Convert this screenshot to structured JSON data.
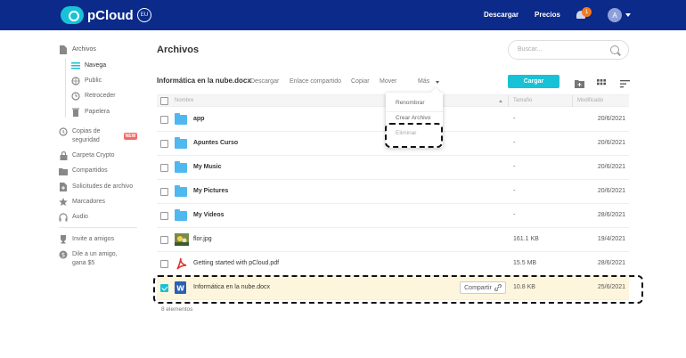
{
  "brand": {
    "name": "pCloud",
    "region": "EU"
  },
  "topnav": {
    "download": "Descargar",
    "prices": "Precios",
    "notifications_count": "1",
    "avatar_initial": "A"
  },
  "sidebar": {
    "files": "Archivos",
    "browse": "Navega",
    "public": "Public",
    "rewind": "Retroceder",
    "trash": "Papelera",
    "backups": "Copias de seguridad",
    "new_badge": "NEW",
    "crypto": "Carpeta Crypto",
    "shared": "Compartidos",
    "file_requests": "Solicitudes de archivo",
    "bookmarks": "Marcadores",
    "audio": "Audio",
    "invite": "Invite a amigos",
    "refer": "Dile a un amigo, gana $5"
  },
  "main": {
    "title": "Archivos",
    "search_placeholder": "Buscar...",
    "selected_file": "Informática en la nube.docx",
    "actions": {
      "download": "Descargar",
      "share_link": "Enlace compartido",
      "copy": "Copiar",
      "move": "Mover",
      "more": "Más"
    },
    "upload": "Cargar",
    "columns": {
      "name": "Nombre",
      "size": "Tamaño",
      "modified": "Modificado"
    },
    "more_menu": [
      "Renombrar",
      "Crear Archivo",
      "Eliminar"
    ],
    "rows": [
      {
        "name": "app",
        "size": "-",
        "date": "20/6/2021",
        "type": "folder"
      },
      {
        "name": "Apuntes Curso",
        "size": "-",
        "date": "20/6/2021",
        "type": "folder"
      },
      {
        "name": "My Music",
        "size": "-",
        "date": "20/6/2021",
        "type": "folder"
      },
      {
        "name": "My Pictures",
        "size": "-",
        "date": "20/6/2021",
        "type": "folder"
      },
      {
        "name": "My Videos",
        "size": "-",
        "date": "28/6/2021",
        "type": "folder"
      },
      {
        "name": "flor.jpg",
        "size": "161.1 KB",
        "date": "19/4/2021",
        "type": "image"
      },
      {
        "name": "Getting started with pCloud.pdf",
        "size": "15.5 MB",
        "date": "28/6/2021",
        "type": "pdf"
      },
      {
        "name": "Informática en la nube.docx",
        "size": "10.8 KB",
        "date": "25/6/2021",
        "type": "doc",
        "selected": true,
        "share_label": "Compartir"
      }
    ],
    "count": "8 elementos"
  },
  "colors": {
    "header": "#0b2a8a",
    "accent": "#17c2d6",
    "folder": "#4fb8ee",
    "new": "#f26b6b",
    "selected_row": "#fdf6dd"
  }
}
